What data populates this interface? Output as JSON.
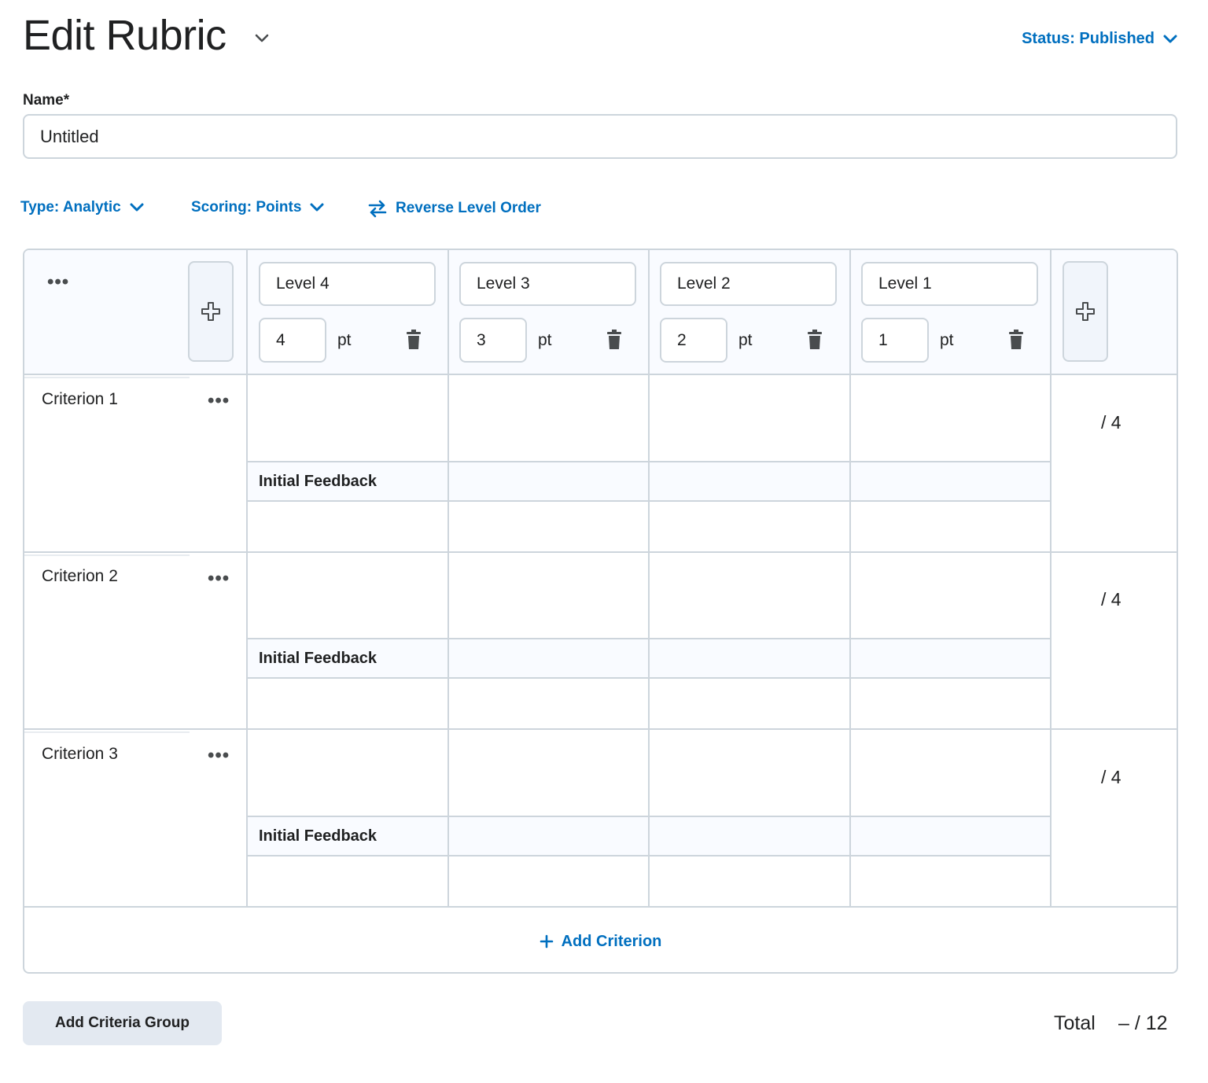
{
  "header": {
    "title": "Edit Rubric",
    "status_label": "Status: Published"
  },
  "name_field": {
    "label": "Name*",
    "value": "Untitled"
  },
  "options": {
    "type_label": "Type: Analytic",
    "scoring_label": "Scoring: Points",
    "reverse_label": "Reverse Level Order"
  },
  "levels": [
    {
      "name": "Level 4",
      "points": "4",
      "unit": "pt"
    },
    {
      "name": "Level 3",
      "points": "3",
      "unit": "pt"
    },
    {
      "name": "Level 2",
      "points": "2",
      "unit": "pt"
    },
    {
      "name": "Level 1",
      "points": "1",
      "unit": "pt"
    }
  ],
  "criteria": [
    {
      "name": "Criterion 1",
      "score": "/ 4",
      "feedback_label": "Initial Feedback"
    },
    {
      "name": "Criterion 2",
      "score": "/ 4",
      "feedback_label": "Initial Feedback"
    },
    {
      "name": "Criterion 3",
      "score": "/ 4",
      "feedback_label": "Initial Feedback"
    }
  ],
  "actions": {
    "add_criterion": "Add Criterion",
    "add_criteria_group": "Add Criteria Group"
  },
  "total": {
    "label": "Total",
    "value": "– / 12"
  },
  "colors": {
    "link": "#006fbf",
    "border": "#cdd5dc",
    "header_bg": "#f9fbff",
    "button_bg": "#e3e9f1"
  },
  "icons": [
    "chevron-down-icon",
    "swap-icon",
    "plus-icon",
    "trash-icon",
    "more-icon"
  ]
}
